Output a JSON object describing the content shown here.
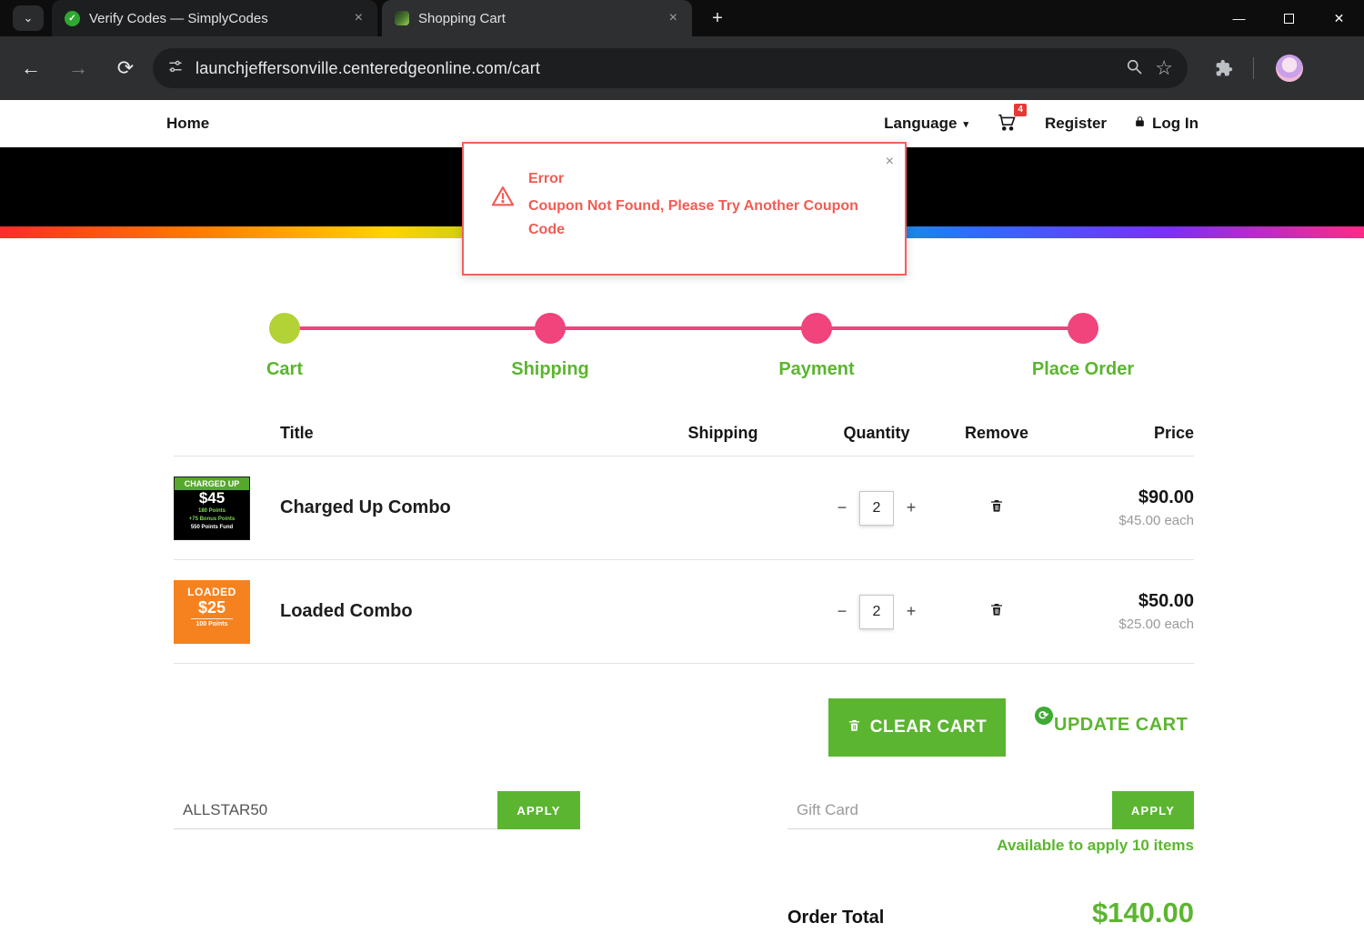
{
  "colors": {
    "green": "#5cb531",
    "pink": "#f1437c",
    "cart_step_dot": "#b2d235",
    "error_red": "#f05c55",
    "badge_red": "#e53935",
    "rainbow": [
      "#ff2a2a",
      "#ff7a00",
      "#ffd400",
      "#8bc928",
      "#00b8b0",
      "#2f6bff",
      "#7b2ff7",
      "#ff2a86"
    ]
  },
  "browser": {
    "tabs": [
      {
        "title": "Verify Codes — SimplyCodes"
      },
      {
        "title": "Shopping Cart"
      }
    ],
    "url": "launchjeffersonville.centeredgeonline.com/cart"
  },
  "glyphs": {
    "tab_search": "⌄",
    "tab_close": "×",
    "tab_new": "+",
    "win_min": "—",
    "win_close": "✕",
    "back": "←",
    "forward": "→",
    "reload": "⟳",
    "star": "☆",
    "chevron_down": "▾",
    "minus": "−",
    "plus": "+",
    "modal_close": "×",
    "update_icon": "⟳",
    "favicon_mark": "✓"
  },
  "nav": {
    "home": "Home",
    "language": "Language",
    "cart_badge": "4",
    "register": "Register",
    "login": "Log In"
  },
  "error_modal": {
    "title": "Error",
    "message": "Coupon Not Found, Please Try Another Coupon Code"
  },
  "stepper": {
    "steps": [
      {
        "label": "Cart"
      },
      {
        "label": "Shipping"
      },
      {
        "label": "Payment"
      },
      {
        "label": "Place Order"
      }
    ]
  },
  "cart": {
    "headers": {
      "title": "Title",
      "shipping": "Shipping",
      "quantity": "Quantity",
      "remove": "Remove",
      "price": "Price"
    },
    "items": [
      {
        "title": "Charged Up Combo",
        "quantity": "2",
        "price": "$90.00",
        "unit_price": "$45.00 each",
        "thumb": {
          "band": "CHARGED UP",
          "amount": "$45",
          "line1": "180 Points",
          "line2": "+75 Bonus Points",
          "line3": "550 Points Fund"
        }
      },
      {
        "title": "Loaded Combo",
        "quantity": "2",
        "price": "$50.00",
        "unit_price": "$25.00 each",
        "thumb": {
          "band": "LOADED",
          "amount": "$25",
          "line1": "100 Points"
        }
      }
    ],
    "clear_cart": "CLEAR CART",
    "update_cart": "UPDATE CART"
  },
  "coupon": {
    "value": "ALLSTAR50",
    "apply": "APPLY"
  },
  "giftcard": {
    "placeholder": "Gift Card",
    "apply": "APPLY",
    "available_prefix": "Available to apply",
    "available_strong": "10 items"
  },
  "totals": {
    "label": "Order Total",
    "amount": "$140.00"
  }
}
